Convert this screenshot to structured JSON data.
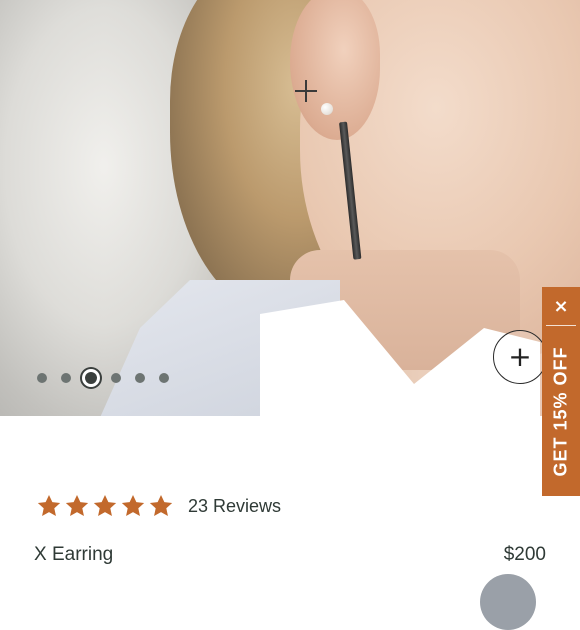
{
  "gallery": {
    "dot_count": 6,
    "active_index": 2,
    "zoom_icon": "plus-icon"
  },
  "promo": {
    "label": "GET 15% OFF",
    "close_glyph": "×",
    "color": "#c2692c"
  },
  "product": {
    "rating": 5,
    "reviews_label": "23 Reviews",
    "name": "X Earring",
    "price": "$200",
    "star_color": "#c2692c"
  }
}
